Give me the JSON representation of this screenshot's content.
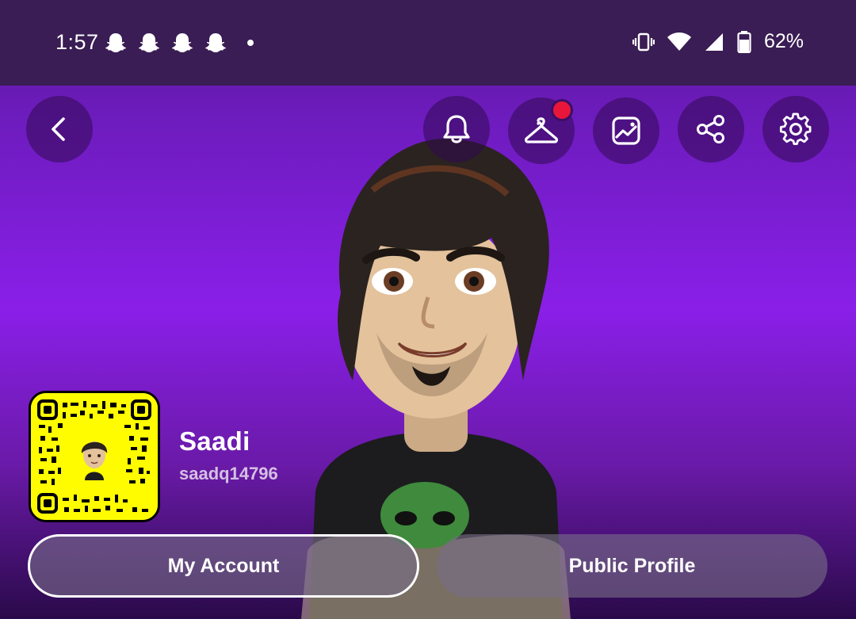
{
  "status_bar": {
    "time": "1:57",
    "notification_icons": [
      "snapchat-ghost-icon",
      "snapchat-ghost-icon",
      "snapchat-ghost-icon",
      "snapchat-ghost-icon"
    ],
    "battery_percent": "62%"
  },
  "toolbar": {
    "icons": [
      "back-arrow-icon",
      "bell-icon",
      "hanger-icon",
      "photo-icon",
      "share-icon",
      "gear-icon"
    ],
    "wardrobe_badge": true
  },
  "profile": {
    "display_name": "Saadi",
    "username": "saadq14796"
  },
  "buttons": {
    "my_account": "My Account",
    "public_profile": "Public Profile"
  },
  "colors": {
    "snapcode_yellow": "#fffc00",
    "badge_red": "#e8163a",
    "background_purple": "#8a1fe8"
  }
}
